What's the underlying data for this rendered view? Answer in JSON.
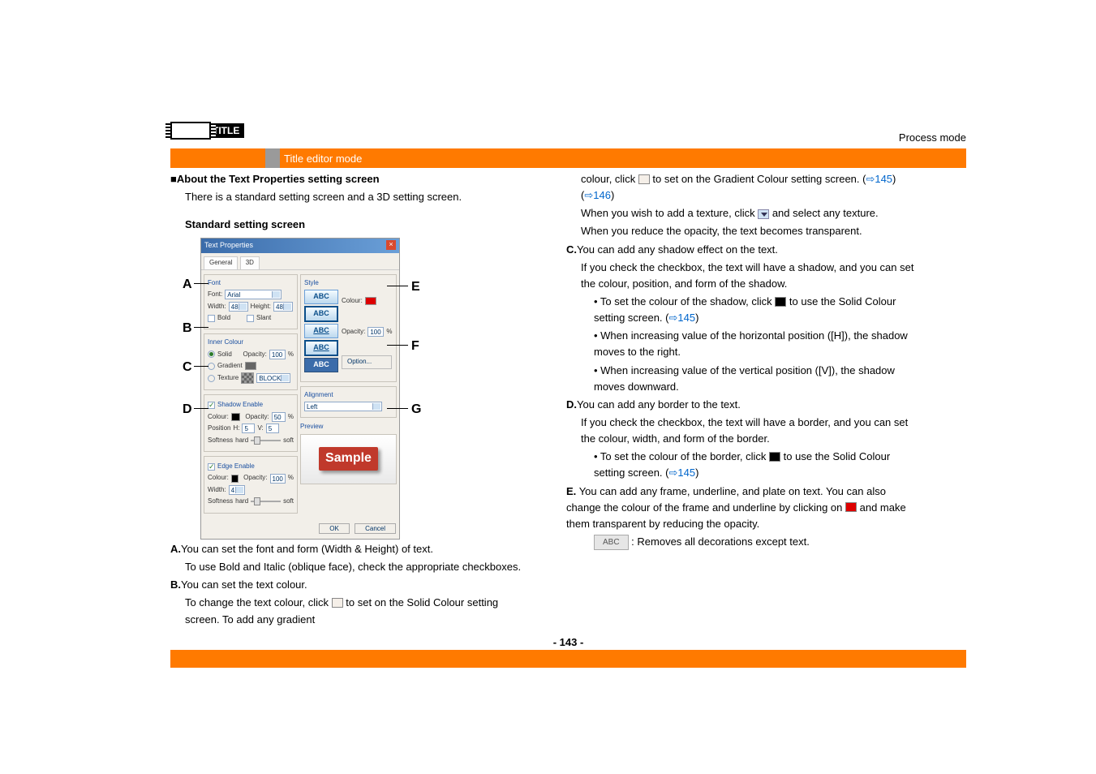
{
  "header": {
    "title_logo_text": "TITLE",
    "process_mode": "Process mode",
    "section_title": "Title editor mode"
  },
  "page_number": "- 143 -",
  "left": {
    "heading": "About the Text Properties setting screen",
    "intro": "There is a standard setting screen and a 3D setting screen.",
    "subheading": "Standard setting screen",
    "a_title": "A.",
    "a_text1": "You can set the font and form (Width & Height) of text.",
    "a_text2": "To use Bold and Italic (oblique face), check the appropriate checkboxes.",
    "b_title": "B.",
    "b_text1": "You can set the text colour.",
    "b_text2_a": "To change the text colour, click ",
    "b_text2_b": " to set on the Solid Colour setting screen. To add any gradient"
  },
  "right": {
    "line1_a": "colour, click ",
    "line1_b": " to set on the Gradient Colour setting screen. (",
    "link145a": "⇨145",
    "line1_c": ") (",
    "link146": "⇨146",
    "line1_d": ")",
    "line2_a": "When you wish to add a texture, click ",
    "line2_b": " and select any texture.",
    "line3": "When you reduce the opacity, the text becomes transparent.",
    "c_title": "C.",
    "c_text1": "You can add any shadow effect on the text.",
    "c_text2": "If you check the checkbox, the text will have a shadow, and you can set the colour, position, and form of the shadow.",
    "c_b1_a": "• To set the colour of the shadow, click ",
    "c_b1_b": " to use the Solid Colour setting screen. (",
    "link145b": "⇨145",
    "c_b1_c": ")",
    "c_b2": "• When increasing value of the horizontal position ([H]), the shadow moves to the right.",
    "c_b3": "• When increasing value of the vertical position ([V]), the shadow moves downward.",
    "d_title": "D.",
    "d_text1": "You can add any border to the text.",
    "d_text2": "If you check the checkbox, the text will have a border, and you can set the colour, width, and form of the border.",
    "d_b1_a": "• To set the colour of the border, click ",
    "d_b1_b": " to use the Solid Colour setting screen. (",
    "link145c": "⇨145",
    "d_b1_c": ")",
    "e_title": "E.",
    "e_text1": "You can add any frame, underline, and plate on text. You can also change the colour of the frame and underline by clicking on ",
    "e_text2": " and make them transparent by reducing the opacity.",
    "e_abc_a": "",
    "e_abc_b": " : Removes all decorations except text."
  },
  "dialog": {
    "title": "Text Properties",
    "tab1": "General",
    "tab2": "3D",
    "font_title": "Font",
    "font_label": "Font:",
    "font_value": "Arial",
    "width_label": "Width:",
    "width_value": "48",
    "height_label": "Height:",
    "height_value": "48",
    "bold": "Bold",
    "slant": "Slant",
    "inner_title": "Inner Colour",
    "solid": "Solid",
    "gradient": "Gradient",
    "texture": "Texture",
    "block": "BLOCK",
    "opacity_label": "Opacity:",
    "opacity_value": "100",
    "pct": "%",
    "shadow_title": "Shadow Enable",
    "colour_label": "Colour:",
    "shadow_opacity": "50",
    "pos_label": "Position",
    "h_label": "H:",
    "h_value": "5",
    "v_label": "V:",
    "v_value": "5",
    "softness": "Softness",
    "hard": "hard",
    "soft": "soft",
    "edge_title": "Edge Enable",
    "edge_opacity": "100",
    "edge_width_label": "Width:",
    "edge_width_value": "4",
    "style_title": "Style",
    "abc": "ABC",
    "style_opacity": "100",
    "option": "Option...",
    "align_title": "Alignment",
    "align_value": "Left",
    "preview_title": "Preview",
    "sample": "Sample",
    "ok": "OK",
    "cancel": "Cancel"
  },
  "callouts": {
    "a": "A",
    "b": "B",
    "c": "C",
    "d": "D",
    "e": "E",
    "f": "F",
    "g": "G"
  }
}
